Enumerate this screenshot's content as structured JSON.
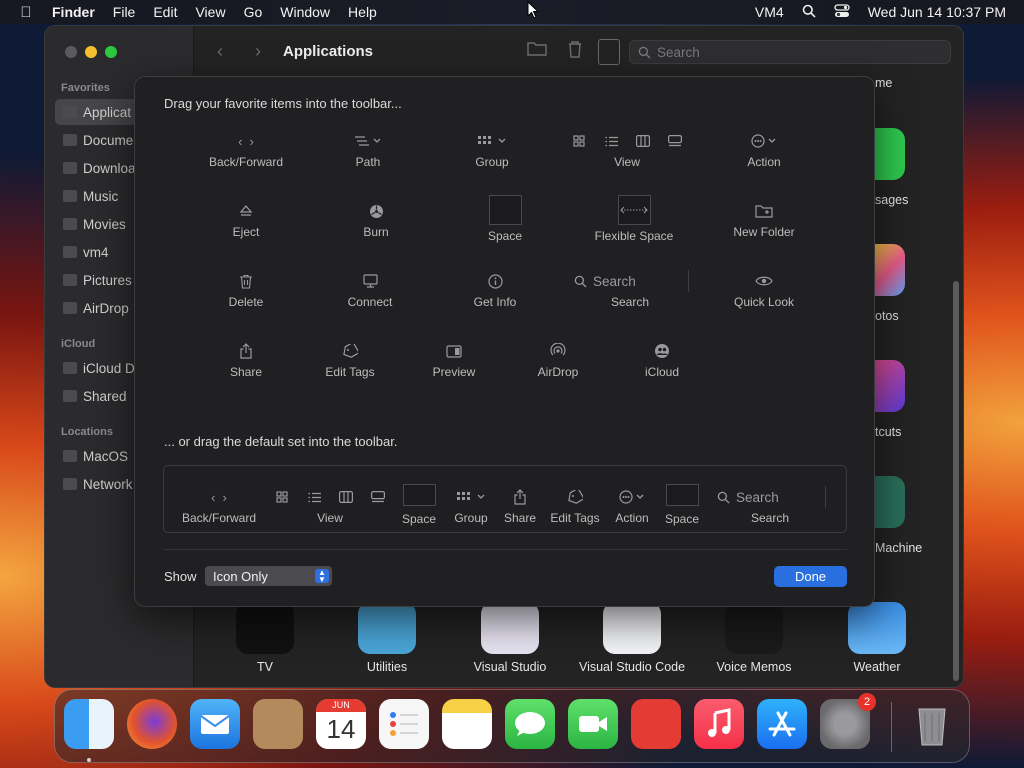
{
  "menubar": {
    "app_name": "Finder",
    "menus": [
      "File",
      "Edit",
      "View",
      "Go",
      "Window",
      "Help"
    ],
    "user": "VM4",
    "datetime": "Wed Jun 14  10:37 PM"
  },
  "finder": {
    "title": "Applications",
    "search_placeholder": "Search",
    "sidebar": {
      "favorites_header": "Favorites",
      "favorites": [
        "Applicat",
        "Docume",
        "Downloa",
        "Music",
        "Movies",
        "vm4",
        "Pictures",
        "AirDrop"
      ],
      "icloud_header": "iCloud",
      "icloud": [
        "iCloud D",
        "Shared"
      ],
      "locations_header": "Locations",
      "locations": [
        "MacOS",
        "Network"
      ]
    },
    "right_column_labels": [
      "me",
      "sages",
      "otos",
      "tcuts",
      "Machine"
    ],
    "bottom_apps": [
      {
        "label": "TV"
      },
      {
        "label": "Utilities"
      },
      {
        "label": "Visual Studio"
      },
      {
        "label": "Visual Studio Code"
      },
      {
        "label": "Voice Memos"
      },
      {
        "label": "Weather"
      }
    ]
  },
  "customize": {
    "drag_hint": "Drag your favorite items into the toolbar...",
    "items": {
      "back_forward": "Back/Forward",
      "path": "Path",
      "group": "Group",
      "view": "View",
      "action": "Action",
      "eject": "Eject",
      "burn": "Burn",
      "space": "Space",
      "flexible_space": "Flexible Space",
      "new_folder": "New Folder",
      "delete": "Delete",
      "connect": "Connect",
      "get_info": "Get Info",
      "search": "Search",
      "search_field_text": "Search",
      "quick_look": "Quick Look",
      "share": "Share",
      "edit_tags": "Edit Tags",
      "preview": "Preview",
      "airdrop": "AirDrop",
      "icloud": "iCloud"
    },
    "default_hint": "... or drag the default set into the toolbar.",
    "default_set": {
      "back_forward": "Back/Forward",
      "view": "View",
      "space1": "Space",
      "group": "Group",
      "share": "Share",
      "edit_tags": "Edit Tags",
      "action": "Action",
      "space2": "Space",
      "search": "Search",
      "search_field_text": "Search"
    },
    "show_label": "Show",
    "show_value": "Icon Only",
    "done_label": "Done"
  },
  "dock": {
    "calendar_month": "JUN",
    "calendar_day": "14",
    "settings_badge": "2"
  },
  "colors": {
    "accent": "#2a6fe0",
    "sheet_bg": "#202022",
    "window_bg": "#232323"
  }
}
